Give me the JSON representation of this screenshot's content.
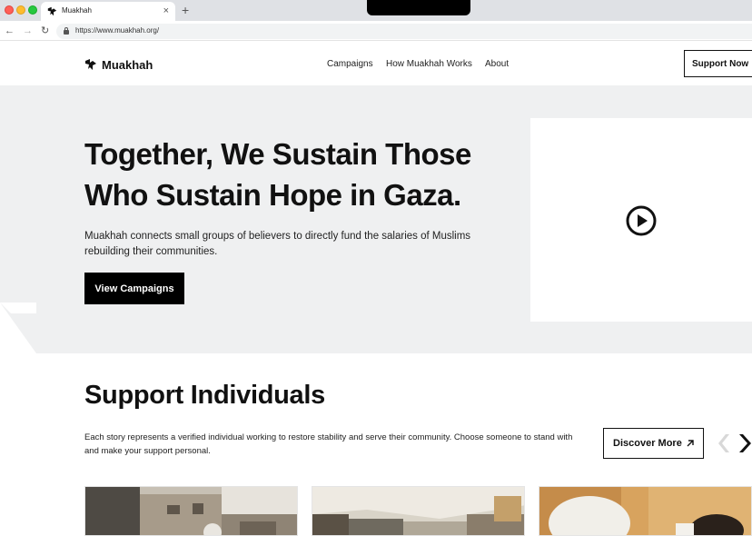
{
  "browser": {
    "tab_title": "Muakhah",
    "tab_close": "×",
    "new_tab": "+",
    "url": "https://www.muakhah.org/",
    "back": "←",
    "forward": "→",
    "reload": "↻"
  },
  "header": {
    "brand": "Muakhah",
    "nav": [
      "Campaigns",
      "How Muakhah Works",
      "About"
    ],
    "cta": "Support Now"
  },
  "hero": {
    "title": "Together, We Sustain Those Who Sustain Hope in Gaza.",
    "subtitle": "Muakhah connects small groups of believers to directly fund the salaries of Muslims rebuilding their communities.",
    "cta": "View Campaigns"
  },
  "support": {
    "title": "Support Individuals",
    "description": "Each story represents a verified individual working to restore stability and serve their community. Choose someone to stand with and make your support personal.",
    "cta": "Discover More"
  },
  "colors": {
    "hero_bg": "#eff0f1",
    "primary": "#000000",
    "primary_text": "#ffffff"
  },
  "icons": [
    "muakhah-logo-icon",
    "play-icon",
    "arrow-up-right-icon",
    "chevron-left-icon",
    "chevron-right-icon",
    "lock-icon"
  ]
}
